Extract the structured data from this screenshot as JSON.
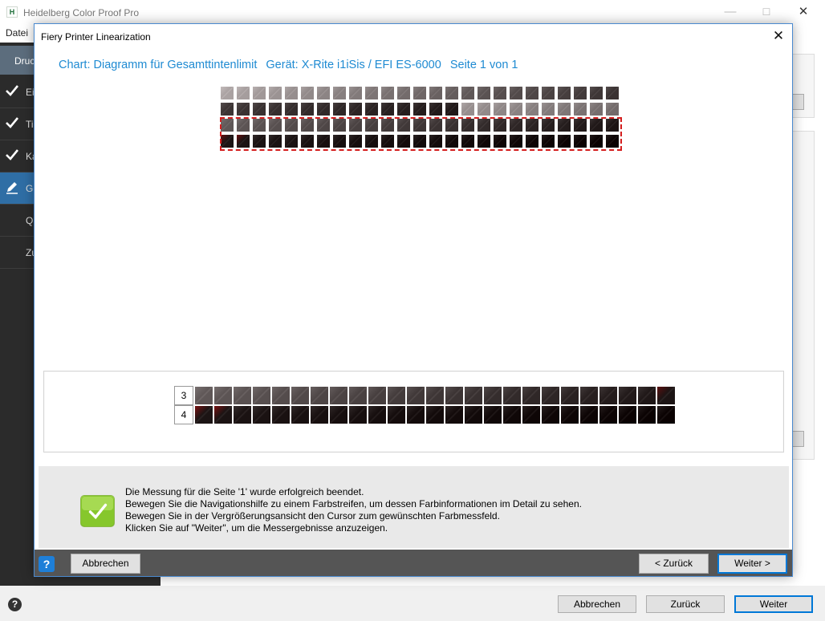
{
  "app": {
    "title": "Heidelberg Color Proof Pro",
    "menu": [
      "Datei"
    ],
    "sidebar": {
      "header": "Druc",
      "items": [
        {
          "label": "Ei",
          "state": "done"
        },
        {
          "label": "Ti",
          "state": "done"
        },
        {
          "label": "Ka",
          "state": "done"
        },
        {
          "label": "Ge",
          "state": "active"
        },
        {
          "label": "Qu",
          "state": "none"
        },
        {
          "label": "Zu",
          "state": "none"
        }
      ]
    },
    "footer": {
      "cancel": "Abbrechen",
      "back": "Zurück",
      "next": "Weiter"
    }
  },
  "dialog": {
    "title": "Fiery Printer Linearization",
    "heading": {
      "chart": "Chart: Diagramm für Gesamttintenlimit",
      "device": "Gerät: X-Rite i1iSis / EFI ES-6000",
      "page": "Seite 1 von 1"
    },
    "zoom_rows": [
      "3",
      "4"
    ],
    "message": [
      "Die Messung für die Seite '1' wurde erfolgreich beendet.",
      "Bewegen Sie die Navigationshilfe zu einem Farbstreifen, um dessen Farbinformationen im Detail zu sehen.",
      "Bewegen Sie in der Vergrößerungsansicht den Cursor zum gewünschten Farbmessfeld.",
      "Klicken Sie auf \"Weiter\", um die Messergebnisse anzuzeigen."
    ],
    "buttons": {
      "cancel": "Abbrechen",
      "back": "< Zurück",
      "next": "Weiter >"
    }
  },
  "colors": {
    "accent": "#1e8ad2",
    "sidebar_bg": "#2b2b2b",
    "sidebar_active": "#2f6ea5",
    "selection": "#d41e1e",
    "footer_bar": "#555555",
    "success": "#7cc51f"
  },
  "icons": {
    "app": "heidelberg-logo-icon",
    "close": "close-icon",
    "help": "help-icon",
    "success": "checkmark-icon"
  }
}
